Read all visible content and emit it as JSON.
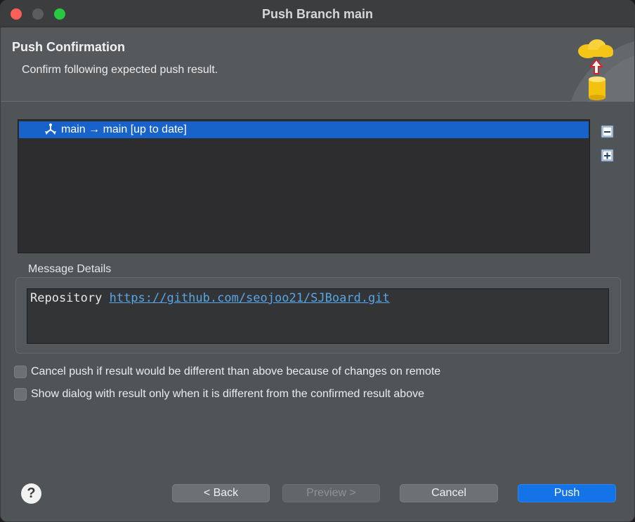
{
  "window": {
    "title": "Push Branch main"
  },
  "header": {
    "title": "Push Confirmation",
    "description": "Confirm following expected push result."
  },
  "tree": {
    "items": [
      {
        "label": "main → main [up to date]",
        "icon": "branch-push-icon",
        "selected": true
      }
    ]
  },
  "message_details": {
    "label": "Message Details",
    "prefix": "Repository ",
    "link": "https://github.com/seojoo21/SJBoard.git"
  },
  "options": [
    {
      "label": "Cancel push if result would be different than above because of changes on remote",
      "checked": false
    },
    {
      "label": "Show dialog with result only when it is different from the confirmed result above",
      "checked": false
    }
  ],
  "buttons": {
    "help": "?",
    "back": "< Back",
    "preview": "Preview >",
    "cancel": "Cancel",
    "push": "Push"
  },
  "colors": {
    "selection": "#1763c9",
    "primary_button": "#1473e6",
    "link": "#58a6e8"
  }
}
